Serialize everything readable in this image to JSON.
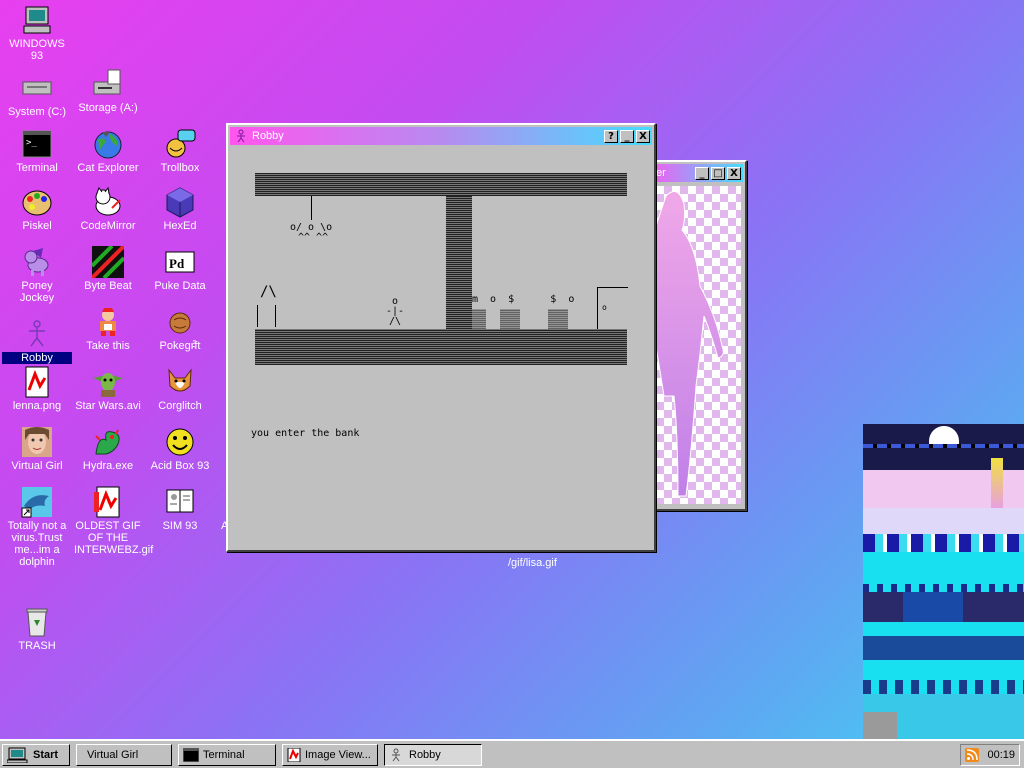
{
  "desktop": {
    "icons": [
      {
        "id": "windows93",
        "label": "WINDOWS 93",
        "icon": "computer-icon"
      },
      {
        "id": "system",
        "label": "System (C:)",
        "icon": "drive-icon"
      },
      {
        "id": "storage",
        "label": "Storage (A:)",
        "icon": "floppy-drive-icon"
      },
      {
        "id": "terminal",
        "label": "Terminal",
        "icon": "terminal-icon"
      },
      {
        "id": "cat-explorer",
        "label": "Cat Explorer",
        "icon": "globe-icon"
      },
      {
        "id": "trollbox",
        "label": "Trollbox",
        "icon": "chat-icon"
      },
      {
        "id": "piskel",
        "label": "Piskel",
        "icon": "palette-icon"
      },
      {
        "id": "codemirror",
        "label": "CodeMirror",
        "icon": "cat-icon"
      },
      {
        "id": "hexed",
        "label": "HexEd",
        "icon": "cube-icon"
      },
      {
        "id": "poney-jockey",
        "label": "Poney Jockey",
        "icon": "pony-icon"
      },
      {
        "id": "byte-beat",
        "label": "Byte Beat",
        "icon": "waveform-icon"
      },
      {
        "id": "puke-data",
        "label": "Puke Data",
        "icon": "pd-icon"
      },
      {
        "id": "robby",
        "label": "Robby",
        "icon": "stick-figure-icon"
      },
      {
        "id": "take-this",
        "label": "Take this",
        "icon": "character-icon"
      },
      {
        "id": "pokecraft",
        "label": "Pokegr̴͒ft",
        "icon": "ball-icon"
      },
      {
        "id": "lenna",
        "label": "lenna.png",
        "icon": "image-file-icon"
      },
      {
        "id": "star-wars",
        "label": "Star Wars.avi",
        "icon": "yoda-icon"
      },
      {
        "id": "corglitch",
        "label": "Corglitch",
        "icon": "corgi-icon"
      },
      {
        "id": "virtual-girl",
        "label": "Virtual Girl",
        "icon": "face-icon"
      },
      {
        "id": "hydra",
        "label": "Hydra.exe",
        "icon": "hydra-icon"
      },
      {
        "id": "acid-box",
        "label": "Acid Box 93",
        "icon": "smiley-icon"
      },
      {
        "id": "dolphin",
        "label": "Totally not a virus.Trust me...im a dolphin",
        "icon": "dolphin-icon"
      },
      {
        "id": "oldest-gif",
        "label": "OLDEST GIF OF THE INTERWEBZ.gif",
        "icon": "gif-file-icon"
      },
      {
        "id": "sim93",
        "label": "SIM 93",
        "icon": "book-icon"
      },
      {
        "id": "trash",
        "label": "TRASH",
        "icon": "recycle-bin-icon"
      }
    ],
    "stray_label": "/gif/lisa.gif",
    "stray_label_partial": "A"
  },
  "robby_window": {
    "title": "Robby",
    "help_btn": "?",
    "min_btn": "_",
    "close_btn": "X",
    "game": {
      "ceiling_figure": "o/ o \\o",
      "ceiling_figure_feet": "^^ ^^",
      "house_roof": "/\\",
      "player_head": "o",
      "player_body": "-|-",
      "player_legs": "/\\",
      "bank_npcs": "m  o  $      $  o",
      "door": "o",
      "message": "you enter the bank"
    }
  },
  "viewer_window": {
    "title_visible": "er",
    "min_btn": "_",
    "max_btn": "□",
    "close_btn": "X"
  },
  "taskbar": {
    "start_label": "Start",
    "tasks": [
      {
        "label": "Virtual Girl",
        "icon": ""
      },
      {
        "label": "Terminal",
        "icon": "terminal-icon"
      },
      {
        "label": "Image View...",
        "icon": "image-file-icon"
      },
      {
        "label": "Robby",
        "icon": "stick-figure-icon",
        "active": true
      }
    ],
    "clock": "00:19",
    "tray_icon": "rss-icon"
  },
  "colors": {
    "title_gradient_start": "#ff55ee",
    "title_gradient_end": "#44ddff",
    "selection": "#000080",
    "window_face": "#c0c0c0"
  }
}
